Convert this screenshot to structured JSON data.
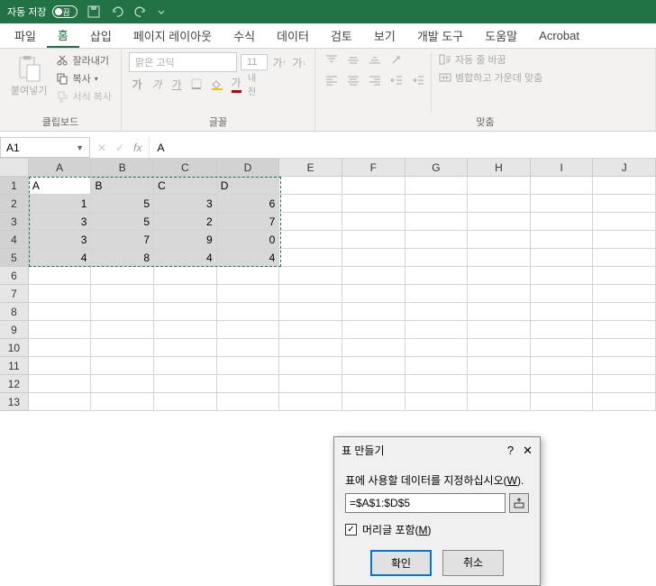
{
  "titlebar": {
    "autosave_label": "자동 저장",
    "autosave_state": "끔"
  },
  "tabs": {
    "file": "파일",
    "home": "홈",
    "insert": "삽입",
    "page_layout": "페이지 레이아웃",
    "formulas": "수식",
    "data": "데이터",
    "review": "검토",
    "view": "보기",
    "developer": "개발 도구",
    "help": "도움말",
    "acrobat": "Acrobat"
  },
  "ribbon": {
    "clipboard": {
      "paste": "붙여넣기",
      "cut": "잘라내기",
      "copy": "복사",
      "format_painter": "서식 복사",
      "group_label": "클립보드"
    },
    "font": {
      "font_name": "맑은 고딕",
      "font_size": "11",
      "style_bold": "가",
      "style_italic": "가",
      "style_underline": "가",
      "ruby": "내천",
      "grow": "가",
      "shrink": "가",
      "group_label": "글꼴"
    },
    "align": {
      "wrap": "자동 줄 바꿈",
      "merge": "병합하고 가운데 맞춤",
      "group_label": "맞춤"
    }
  },
  "namebox": {
    "ref": "A1",
    "formula_value": "A"
  },
  "grid": {
    "cols": [
      "A",
      "B",
      "C",
      "D",
      "E",
      "F",
      "G",
      "H",
      "I",
      "J"
    ],
    "row_count": 13,
    "headers": [
      "A",
      "B",
      "C",
      "D"
    ],
    "data": [
      [
        1,
        5,
        3,
        6
      ],
      [
        3,
        5,
        2,
        7
      ],
      [
        3,
        7,
        9,
        0
      ],
      [
        4,
        8,
        4,
        4
      ]
    ]
  },
  "dialog": {
    "title": "표 만들기",
    "prompt_pre": "표에 사용할 데이터를 지정하십시오(",
    "prompt_key": "W",
    "prompt_post": ").",
    "range": "=$A$1:$D$5",
    "headers_chk_pre": "머리글 포함(",
    "headers_chk_key": "M",
    "headers_chk_post": ")",
    "ok": "확인",
    "cancel": "취소"
  },
  "chart_data": {
    "type": "table",
    "headers": [
      "A",
      "B",
      "C",
      "D"
    ],
    "rows": [
      [
        1,
        5,
        3,
        6
      ],
      [
        3,
        5,
        2,
        7
      ],
      [
        3,
        7,
        9,
        0
      ],
      [
        4,
        8,
        4,
        4
      ]
    ]
  }
}
